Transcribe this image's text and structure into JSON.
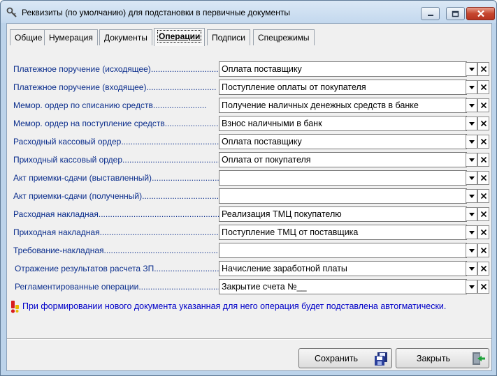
{
  "window": {
    "title": "Реквизиты (по умолчанию) для подстановки в первичные документы"
  },
  "tabs": [
    {
      "label": "Общие"
    },
    {
      "label": "Нумерация"
    },
    {
      "label": "Документы"
    },
    {
      "label": "Операции",
      "active": true
    },
    {
      "label": "Подписи"
    },
    {
      "label": "Спецрежимы"
    }
  ],
  "rows": [
    {
      "label": "Платежное поручение (исходящее)",
      "dots": "..............................",
      "value": "Оплата поставщику"
    },
    {
      "label": "Платежное поручение (входящее)",
      "dots": "..............................",
      "value": "Поступление оплаты от покупателя"
    },
    {
      "label": "Мемор. ордер по списанию средств",
      "dots": ".......................",
      "value": "Получение наличных денежных средств в банке"
    },
    {
      "label": "Мемор. ордер на поступление средств",
      "dots": ".......................",
      "value": "Взнос наличными в банк"
    },
    {
      "label": "Расходный кассовый ордер",
      "dots": "..........................................",
      "value": "Оплата поставщику"
    },
    {
      "label": "Приходный кассовый ордер",
      "dots": "..........................................",
      "value": "Оплата от покупателя"
    },
    {
      "label": "Акт приемки-сдачи (выставленный)",
      "dots": ".............................",
      "value": ""
    },
    {
      "label": "Акт приемки-сдачи (полученный)",
      "dots": "..................................",
      "value": ""
    },
    {
      "label": "Расходная накладная",
      "dots": ".........................................................",
      "value": "Реализация ТМЦ покупателю"
    },
    {
      "label": "Приходная накладная",
      "dots": ".........................................................",
      "value": "Поступление ТМЦ от поставщика"
    },
    {
      "label": "Требование-накладная",
      "dots": "......................................................",
      "value": ""
    },
    {
      "label": "Отражение результатов расчета ЗП",
      "dots": "..............................",
      "value": "Начисление заработной платы"
    },
    {
      "label": "Регламентированные операции",
      "dots": ".........................................",
      "value": "Закрытие счета №__"
    }
  ],
  "note": "При формировании нового документа указанная для него операция будет подставлена автогматически.",
  "buttons": {
    "save": "Сохранить",
    "close": "Закрыть"
  },
  "icons": {
    "title": "wrench-key-icon",
    "dropdown": "chevron-down-icon",
    "clear": "close-icon",
    "note": "exclamation-icon",
    "save": "save-disk-icon",
    "close": "exit-door-icon"
  },
  "colors": {
    "label": "#0a2d8c",
    "note": "#0000c8",
    "close_button": "#c5472f"
  }
}
